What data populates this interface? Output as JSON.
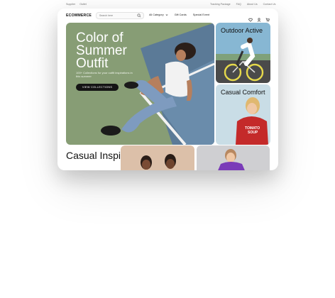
{
  "topbar": {
    "left": [
      "Supplier",
      "Outlet"
    ],
    "right": [
      "Tracking Package",
      "FAQ",
      "About Us",
      "Contact Us"
    ]
  },
  "nav": {
    "logo": "ECOMMERCE",
    "search_placeholder": "Search here",
    "menu": [
      "All Category",
      "Gift Cards",
      "Special Event"
    ]
  },
  "hero": {
    "title": "Color of Summer Outfit",
    "subtitle": "100+ Collections for your outfit inspirations in this summer",
    "button": "VIEW COLLECTIONS"
  },
  "cards": {
    "outdoor": "Outdoor Active",
    "comfort": "Casual Comfort"
  },
  "inspirations": {
    "title": "Casual Inspirations"
  },
  "colors": {
    "hero_bg": "#879d75",
    "accent": "#141414"
  }
}
